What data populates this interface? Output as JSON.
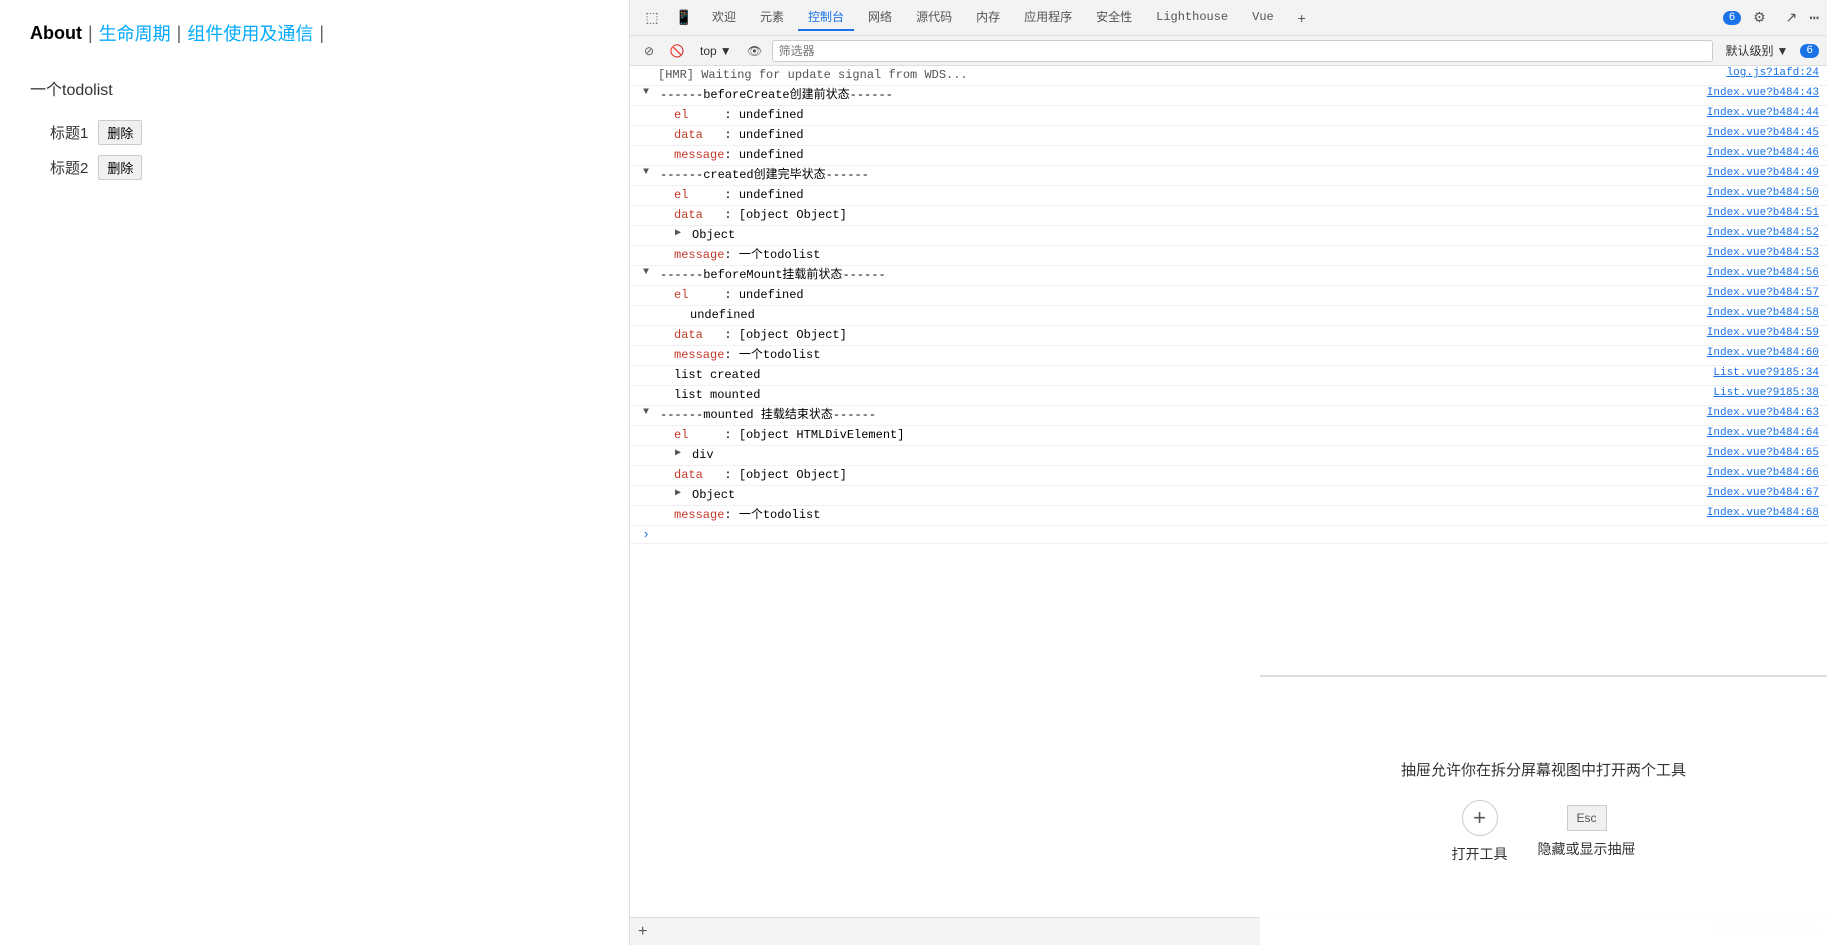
{
  "left": {
    "nav": {
      "about": "About",
      "sep1": " | ",
      "lifecycle": "生命周期",
      "sep2": " | ",
      "component": "组件使用及通信",
      "sep3": " |"
    },
    "section_title": "一个todolist",
    "items": [
      {
        "label": "标题1",
        "btn": "删除"
      },
      {
        "label": "标题2",
        "btn": "删除"
      }
    ]
  },
  "devtools": {
    "top_tabs": [
      "欢迎",
      "元素",
      "控制台",
      "网络",
      "源代码",
      "内存",
      "应用程序",
      "安全性",
      "Lighthouse",
      "Vue"
    ],
    "active_tab": "控制台",
    "badge_count": "6",
    "icons": {
      "cursor": "⬚",
      "phone": "📱",
      "gear": "⚙",
      "share": "↗",
      "more": "⋯",
      "ban": "⊘",
      "eye": "👁",
      "add_tab": "+"
    },
    "second_bar": {
      "top_label": "top",
      "filter_placeholder": "筛选器",
      "level_label": "默认级别",
      "badge": "6"
    },
    "console_lines": [
      {
        "id": 1,
        "indent": 0,
        "icon": "",
        "icon_type": "none",
        "content": "[HMR] Waiting for update signal from WDS...",
        "content_parts": [
          {
            "text": "[HMR] Waiting for update signal from WDS...",
            "color": "gray"
          }
        ],
        "source": "log.js?1afd:24"
      },
      {
        "id": 2,
        "indent": 0,
        "icon": "▼",
        "icon_type": "expand",
        "content": "------beforeCreate创建前状态------",
        "content_parts": [
          {
            "text": "------beforeCreate",
            "color": "black"
          },
          {
            "text": "创建前状态",
            "color": "black"
          },
          {
            "text": "------",
            "color": "black"
          }
        ],
        "source": "Index.vue?b484:43"
      },
      {
        "id": 3,
        "indent": 1,
        "icon": "",
        "icon_type": "none",
        "content": "el     : undefined",
        "content_parts": [
          {
            "text": "el",
            "color": "red"
          },
          {
            "text": "     : ",
            "color": "black"
          },
          {
            "text": "undefined",
            "color": "black"
          }
        ],
        "source": "Index.vue?b484:44"
      },
      {
        "id": 4,
        "indent": 1,
        "icon": "",
        "icon_type": "none",
        "content": "data   : undefined",
        "content_parts": [
          {
            "text": "data",
            "color": "red"
          },
          {
            "text": "   : ",
            "color": "black"
          },
          {
            "text": "undefined",
            "color": "black"
          }
        ],
        "source": "Index.vue?b484:45"
      },
      {
        "id": 5,
        "indent": 1,
        "icon": "",
        "icon_type": "none",
        "content": "message: undefined",
        "content_parts": [
          {
            "text": "message",
            "color": "red"
          },
          {
            "text": ": ",
            "color": "black"
          },
          {
            "text": "undefined",
            "color": "black"
          }
        ],
        "source": "Index.vue?b484:46"
      },
      {
        "id": 6,
        "indent": 0,
        "icon": "▼",
        "icon_type": "expand",
        "content": "------created创建完毕状态------",
        "content_parts": [
          {
            "text": "------created",
            "color": "black"
          },
          {
            "text": "创建完毕状态",
            "color": "black"
          },
          {
            "text": "------",
            "color": "black"
          }
        ],
        "source": "Index.vue?b484:49"
      },
      {
        "id": 7,
        "indent": 1,
        "icon": "",
        "icon_type": "none",
        "content": "el     : undefined",
        "content_parts": [
          {
            "text": "el",
            "color": "red"
          },
          {
            "text": "     : ",
            "color": "black"
          },
          {
            "text": "undefined",
            "color": "black"
          }
        ],
        "source": "Index.vue?b484:50"
      },
      {
        "id": 8,
        "indent": 1,
        "icon": "",
        "icon_type": "none",
        "content": "data   : [object Object]",
        "content_parts": [
          {
            "text": "data",
            "color": "red"
          },
          {
            "text": "   : ",
            "color": "black"
          },
          {
            "text": "[object Object]",
            "color": "black"
          }
        ],
        "source": "Index.vue?b484:51"
      },
      {
        "id": 9,
        "indent": 2,
        "icon": "▶",
        "icon_type": "collapsed",
        "content": "Object",
        "content_parts": [
          {
            "text": "Object",
            "color": "black"
          }
        ],
        "source": "Index.vue?b484:52"
      },
      {
        "id": 10,
        "indent": 1,
        "icon": "",
        "icon_type": "none",
        "content": "message: 一个todolist",
        "content_parts": [
          {
            "text": "message",
            "color": "red"
          },
          {
            "text": ": ",
            "color": "black"
          },
          {
            "text": "一个todolist",
            "color": "black"
          }
        ],
        "source": "Index.vue?b484:53"
      },
      {
        "id": 11,
        "indent": 0,
        "icon": "▼",
        "icon_type": "expand",
        "content": "------beforeMount挂载前状态------",
        "content_parts": [
          {
            "text": "------beforeMount",
            "color": "black"
          },
          {
            "text": "挂载前状态",
            "color": "black"
          },
          {
            "text": "------",
            "color": "black"
          }
        ],
        "source": "Index.vue?b484:56"
      },
      {
        "id": 12,
        "indent": 1,
        "icon": "",
        "icon_type": "none",
        "content": "el     : undefined",
        "content_parts": [
          {
            "text": "el",
            "color": "red"
          },
          {
            "text": "     : ",
            "color": "black"
          },
          {
            "text": "undefined",
            "color": "black"
          }
        ],
        "source": "Index.vue?b484:57"
      },
      {
        "id": 13,
        "indent": 2,
        "icon": "",
        "icon_type": "none",
        "content": "undefined",
        "content_parts": [
          {
            "text": "undefined",
            "color": "black"
          }
        ],
        "source": "Index.vue?b484:58"
      },
      {
        "id": 14,
        "indent": 1,
        "icon": "",
        "icon_type": "none",
        "content": "data   : [object Object]",
        "content_parts": [
          {
            "text": "data",
            "color": "red"
          },
          {
            "text": "   : ",
            "color": "black"
          },
          {
            "text": "[object Object]",
            "color": "black"
          }
        ],
        "source": "Index.vue?b484:59"
      },
      {
        "id": 15,
        "indent": 1,
        "icon": "",
        "icon_type": "none",
        "content": "message: 一个todolist",
        "content_parts": [
          {
            "text": "message",
            "color": "red"
          },
          {
            "text": ": ",
            "color": "black"
          },
          {
            "text": "一个todolist",
            "color": "black"
          }
        ],
        "source": "Index.vue?b484:60"
      },
      {
        "id": 16,
        "indent": 1,
        "icon": "",
        "icon_type": "none",
        "content": "list created",
        "content_parts": [
          {
            "text": "list created",
            "color": "black"
          }
        ],
        "source": "List.vue?9185:34"
      },
      {
        "id": 17,
        "indent": 1,
        "icon": "",
        "icon_type": "none",
        "content": "list mounted",
        "content_parts": [
          {
            "text": "list mounted",
            "color": "black"
          }
        ],
        "source": "List.vue?9185:38"
      },
      {
        "id": 18,
        "indent": 0,
        "icon": "▼",
        "icon_type": "expand",
        "content": "------mounted挂载结束状态------",
        "content_parts": [
          {
            "text": "------mounted ",
            "color": "black"
          },
          {
            "text": "挂载结束状态",
            "color": "black"
          },
          {
            "text": "------",
            "color": "black"
          }
        ],
        "source": "Index.vue?b484:63"
      },
      {
        "id": 19,
        "indent": 1,
        "icon": "",
        "icon_type": "none",
        "content": "el     : [object HTMLDivElement]",
        "content_parts": [
          {
            "text": "el",
            "color": "red"
          },
          {
            "text": "     : ",
            "color": "black"
          },
          {
            "text": "[object HTMLDivElement]",
            "color": "black"
          }
        ],
        "source": "Index.vue?b484:64"
      },
      {
        "id": 20,
        "indent": 2,
        "icon": "▶",
        "icon_type": "collapsed",
        "content": "div",
        "content_parts": [
          {
            "text": "div",
            "color": "black"
          }
        ],
        "source": "Index.vue?b484:65"
      },
      {
        "id": 21,
        "indent": 1,
        "icon": "",
        "icon_type": "none",
        "content": "data   : [object Object]",
        "content_parts": [
          {
            "text": "data",
            "color": "red"
          },
          {
            "text": "   : ",
            "color": "black"
          },
          {
            "text": "[object Object]",
            "color": "black"
          }
        ],
        "source": "Index.vue?b484:66"
      },
      {
        "id": 22,
        "indent": 2,
        "icon": "▶",
        "icon_type": "collapsed",
        "content": "Object",
        "content_parts": [
          {
            "text": "Object",
            "color": "black"
          }
        ],
        "source": "Index.vue?b484:67"
      },
      {
        "id": 23,
        "indent": 1,
        "icon": "",
        "icon_type": "none",
        "content": "message: 一个todolist",
        "content_parts": [
          {
            "text": "message",
            "color": "red"
          },
          {
            "text": ": ",
            "color": "black"
          },
          {
            "text": "一个todolist",
            "color": "black"
          }
        ],
        "source": "Index.vue?b484:68"
      }
    ],
    "add_bar_icon": "+",
    "drawer": {
      "title": "抽屉允许你在拆分屏幕视图中打开两个工具",
      "open_tool_label": "打开工具",
      "hide_label": "隐藏或显示抽屉",
      "esc_label": "Esc"
    },
    "watermark": "@稀土掘金技术社区"
  }
}
